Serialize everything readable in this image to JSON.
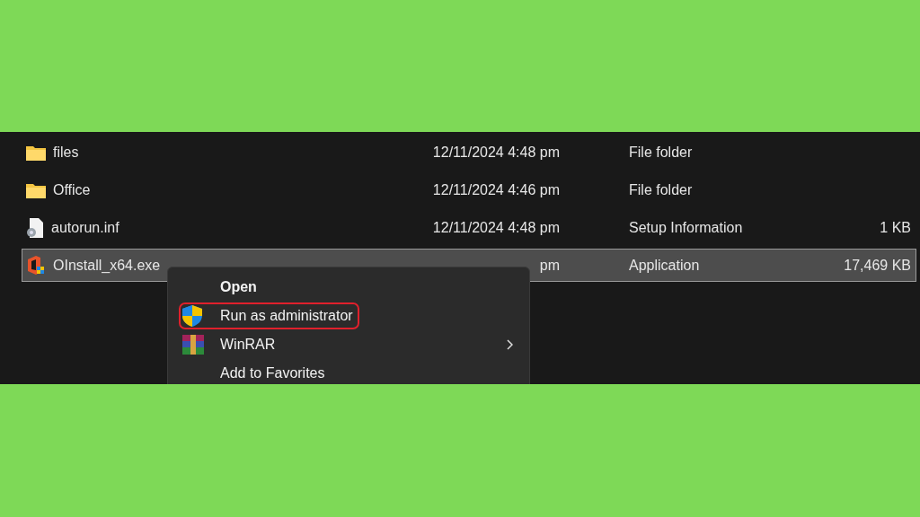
{
  "files": [
    {
      "name": "files",
      "kind": "folder",
      "date": "12/11/2024 4:48 pm",
      "type": "File folder",
      "selected": false
    },
    {
      "name": "Office",
      "kind": "folder",
      "date": "12/11/2024 4:46 pm",
      "type": "File folder",
      "selected": false
    },
    {
      "name": "autorun.inf",
      "kind": "settings-file",
      "date": "12/11/2024 4:48 pm",
      "type": "Setup Information",
      "size": "1 KB",
      "selected": false
    },
    {
      "name": "OInstall_x64.exe",
      "kind": "installer",
      "date": "pm",
      "type": "Application",
      "size": "17,469 KB",
      "selected": true
    }
  ],
  "context_menu": {
    "items": [
      {
        "label": "Open",
        "kind": "plain",
        "default": true,
        "highlighted": false,
        "submenu": false
      },
      {
        "label": "Run as administrator",
        "kind": "shield",
        "default": false,
        "highlighted": true,
        "submenu": false
      },
      {
        "label": "WinRAR",
        "kind": "archive",
        "default": false,
        "highlighted": false,
        "submenu": true
      },
      {
        "label": "Add to Favorites",
        "kind": "plain",
        "default": false,
        "highlighted": false,
        "submenu": false
      }
    ]
  }
}
